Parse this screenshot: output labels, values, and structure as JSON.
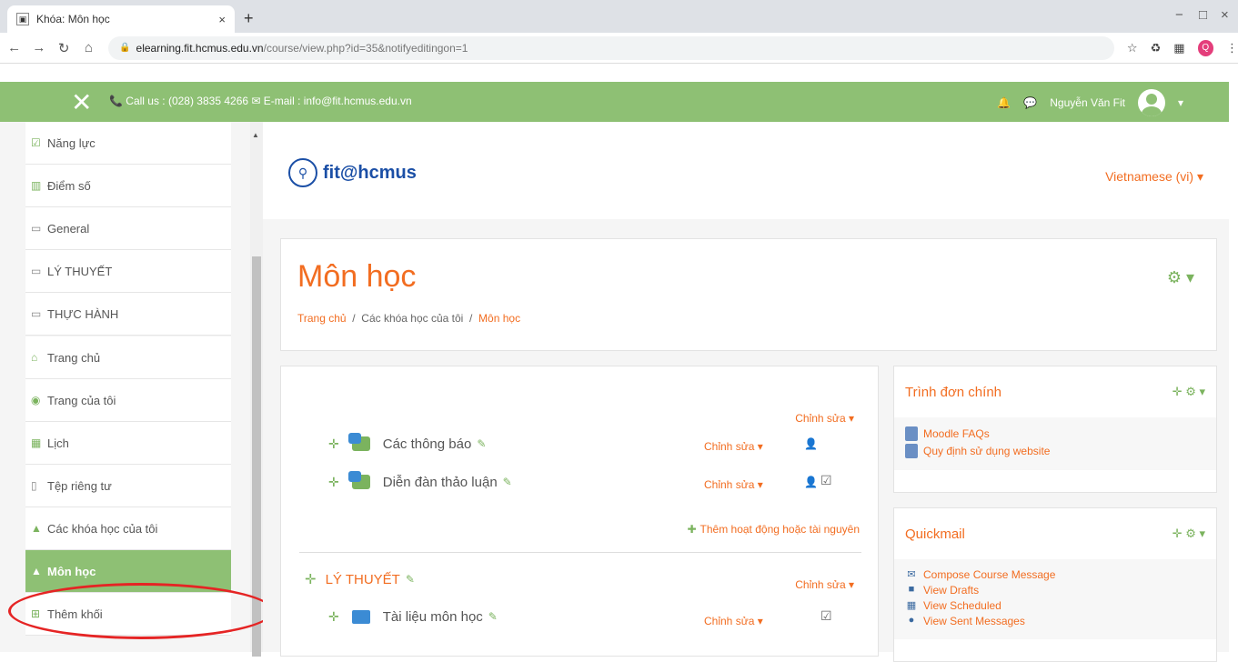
{
  "browser": {
    "tab_title": "Khóa: Môn học",
    "tab_close": "×",
    "new_tab": "+",
    "url_host": "elearning.fit.hcmus.edu.vn",
    "url_path": "/course/view.php?id=35&notifyeditingon=1",
    "profile_initial": "Q",
    "window_controls": {
      "minimize": "−",
      "maximize": "□",
      "close": "×"
    }
  },
  "topnav": {
    "contact": "Call us : (028) 3835 4266 ✉ E-mail : info@fit.hcmus.edu.vn",
    "user_name": "Nguyễn Văn Fit",
    "bg_color": "#8ec074"
  },
  "sidebar": {
    "items": [
      {
        "label": "Năng lực",
        "icon": "checkbox-icon"
      },
      {
        "label": "Điểm số",
        "icon": "grades-icon"
      },
      {
        "label": "General",
        "icon": "folder-icon"
      },
      {
        "label": "LÝ THUYẾT",
        "icon": "folder-icon"
      },
      {
        "label": "THỰC HÀNH",
        "icon": "folder-icon"
      },
      {
        "label": "Trang chủ",
        "icon": "home-icon"
      },
      {
        "label": "Trang của tôi",
        "icon": "dashboard-icon"
      },
      {
        "label": "Lịch",
        "icon": "calendar-icon"
      },
      {
        "label": "Tệp riêng tư",
        "icon": "file-icon"
      },
      {
        "label": "Các khóa học của tôi",
        "icon": "graduation-cap-icon"
      },
      {
        "label": "Môn học",
        "icon": "graduation-cap-icon",
        "active": true
      },
      {
        "label": "Thêm khối",
        "icon": "plus-square-icon"
      }
    ]
  },
  "header": {
    "logo_text": "fit@hcmus",
    "language": "Vietnamese (vi) ▾"
  },
  "page": {
    "title": "Môn học",
    "breadcrumb": {
      "home": "Trang chủ",
      "sep": "/",
      "my_courses": "Các khóa học của tôi",
      "current": "Môn học"
    }
  },
  "course": {
    "top_edit": "Chỉnh sửa ▾",
    "activities": [
      {
        "name": "Các thông báo",
        "edit": "Chỉnh sửa ▾"
      },
      {
        "name": "Diễn đàn thảo luận",
        "edit": "Chỉnh sửa ▾"
      }
    ],
    "add_activity": "Thêm hoạt động hoặc tài nguyên",
    "section_title": "LÝ THUYẾT",
    "section_edit": "Chỉnh sửa ▾",
    "section_activities": [
      {
        "name": "Tài liệu môn học",
        "edit": "Chỉnh sửa ▾"
      }
    ]
  },
  "blocks": {
    "main_menu": {
      "title": "Trình đơn chính",
      "links": [
        "Moodle FAQs",
        "Quy định sử dụng website"
      ]
    },
    "quickmail": {
      "title": "Quickmail",
      "links": [
        "Compose Course Message",
        "View Drafts",
        "View Scheduled",
        "View Sent Messages"
      ]
    }
  }
}
